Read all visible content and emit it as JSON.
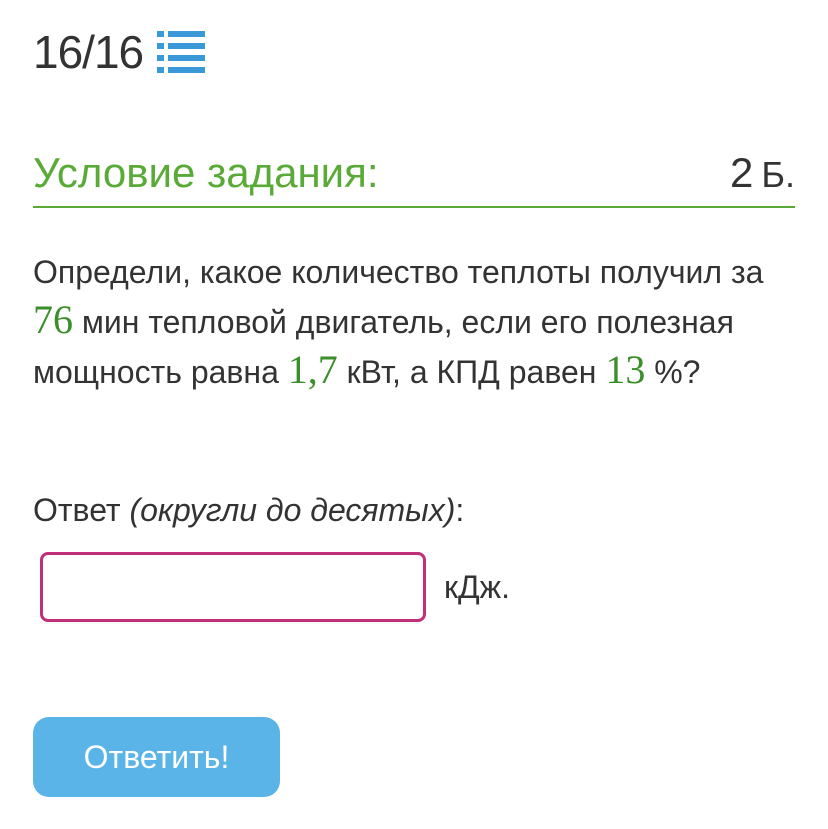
{
  "progress": {
    "text": "16/16",
    "list_icon": "list-icon",
    "icon_color": "#3a9ad9"
  },
  "task": {
    "header_title": "Условие задания:",
    "points_value": "2",
    "points_unit": "Б.",
    "accent_color": "#5aaa38",
    "condition": {
      "part1": "Определи, какое количество теплоты получил за ",
      "time": "76",
      "part2": " мин тепловой двигатель, если его полезная мощность равна ",
      "power": "1,7",
      "part3": " кВт, а КПД равен ",
      "efficiency": "13",
      "part4": " %?"
    }
  },
  "answer": {
    "label": "Ответ ",
    "hint": "(округли до десятых)",
    "label_end": ":",
    "input_value": "",
    "unit": "кДж.",
    "border_color": "#c0307a"
  },
  "submit": {
    "label": "Ответить!",
    "color": "#5bb4e8"
  }
}
